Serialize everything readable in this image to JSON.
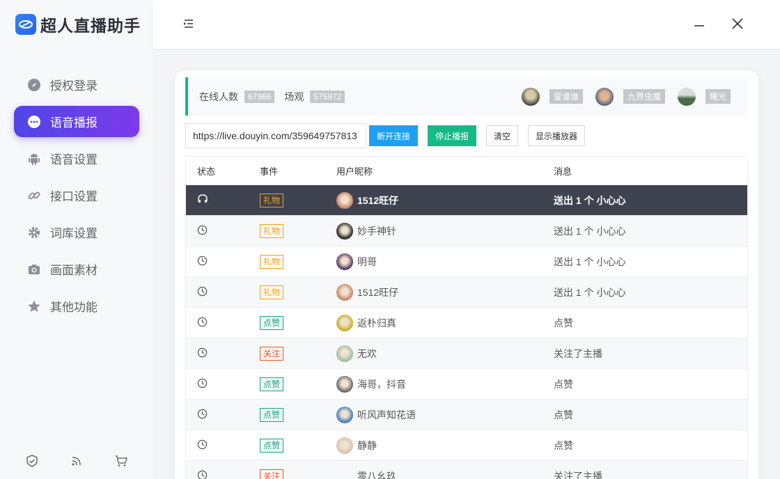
{
  "app": {
    "title": "超人直播助手"
  },
  "sidebar": {
    "items": [
      {
        "label": "授权登录",
        "icon": "compass-icon",
        "active": false
      },
      {
        "label": "语音播报",
        "icon": "chat-bubble-icon",
        "active": true
      },
      {
        "label": "语音设置",
        "icon": "android-icon",
        "active": false
      },
      {
        "label": "接口设置",
        "icon": "link-icon",
        "active": false
      },
      {
        "label": "词库设置",
        "icon": "gear-icon",
        "active": false
      },
      {
        "label": "画面素材",
        "icon": "camera-icon",
        "active": false
      },
      {
        "label": "其他功能",
        "icon": "star-icon",
        "active": false
      }
    ],
    "footer_icons": [
      "shield-check-icon",
      "rss-icon",
      "cart-icon"
    ]
  },
  "stats": {
    "online_label": "在线人数",
    "online_value": "67966",
    "session_label": "场观",
    "session_value": "575972",
    "viewers": [
      {
        "name": "爱谁谁"
      },
      {
        "name": "九界虫魔"
      },
      {
        "name": "曙光"
      }
    ]
  },
  "controls": {
    "url_value": "https://live.douyin.com/359649757813",
    "disconnect_label": "断开连接",
    "stop_label": "停止播报",
    "clear_label": "清空",
    "show_player_label": "显示播放器"
  },
  "table": {
    "headers": {
      "status": "状态",
      "event": "事件",
      "nickname": "用户昵称",
      "message": "消息"
    },
    "rows": [
      {
        "status": "headphones-icon",
        "event": "礼物",
        "type": "gift",
        "nickname": "1512旺仔",
        "message": "送出 1 个 小心心",
        "avatar": "#c98a6a"
      },
      {
        "status": "clock-icon",
        "event": "礼物",
        "type": "gift",
        "nickname": "妙手神针",
        "message": "送出 1 个 小心心",
        "avatar": "#2b2b2b"
      },
      {
        "status": "clock-icon",
        "event": "礼物",
        "type": "gift",
        "nickname": "明哥",
        "message": "送出 1 个 小心心",
        "avatar": "#5a3a6e"
      },
      {
        "status": "clock-icon",
        "event": "礼物",
        "type": "gift",
        "nickname": "1512旺仔",
        "message": "送出 1 个 小心心",
        "avatar": "#c98a6a"
      },
      {
        "status": "clock-icon",
        "event": "点赞",
        "type": "like",
        "nickname": "返朴归真",
        "message": "点赞",
        "avatar": "#c9b22a"
      },
      {
        "status": "clock-icon",
        "event": "关注",
        "type": "follow",
        "nickname": "无欢",
        "message": "关注了主播",
        "avatar": "#9ec2a0"
      },
      {
        "status": "clock-icon",
        "event": "点赞",
        "type": "like",
        "nickname": "海哥，抖音",
        "message": "点赞",
        "avatar": "#6b6b6b"
      },
      {
        "status": "clock-icon",
        "event": "点赞",
        "type": "like",
        "nickname": "听风声知花语",
        "message": "点赞",
        "avatar": "#4a7fc1"
      },
      {
        "status": "clock-icon",
        "event": "点赞",
        "type": "like",
        "nickname": "静静",
        "message": "点赞",
        "avatar": "#d8c4b0"
      },
      {
        "status": "clock-icon",
        "event": "关注",
        "type": "follow",
        "nickname": "零八幺玖",
        "message": "关注了主播",
        "avatar": ""
      }
    ]
  },
  "colors": {
    "accent": "#4f46e5",
    "green": "#16b886",
    "blue": "#1e9ff2",
    "selected_row": "#3f4350"
  }
}
